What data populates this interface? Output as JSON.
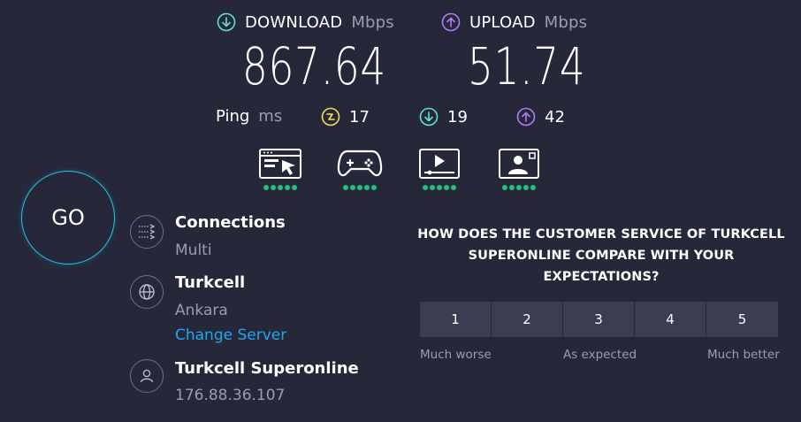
{
  "download": {
    "label": "DOWNLOAD",
    "unit": "Mbps",
    "value": "867.64",
    "icon": "download-arrow-icon",
    "color": "#5ee3d6"
  },
  "upload": {
    "label": "UPLOAD",
    "unit": "Mbps",
    "value": "51.74",
    "icon": "upload-arrow-icon",
    "color": "#b07cf5"
  },
  "ping": {
    "label": "Ping",
    "unit": "ms",
    "idle": {
      "value": "17",
      "icon": "idle-ping-icon",
      "color": "#f5df5a"
    },
    "download": {
      "value": "19",
      "icon": "download-ping-icon",
      "color": "#5ee3d6"
    },
    "upload": {
      "value": "42",
      "icon": "upload-ping-icon",
      "color": "#b07cf5"
    }
  },
  "activities": [
    {
      "name": "web-browsing-icon",
      "rating": 5
    },
    {
      "name": "gaming-icon",
      "rating": 5
    },
    {
      "name": "video-streaming-icon",
      "rating": 5
    },
    {
      "name": "video-chat-icon",
      "rating": 5
    }
  ],
  "go_button": {
    "label": "GO"
  },
  "connections": {
    "title": "Connections",
    "value": "Multi"
  },
  "server": {
    "title": "Turkcell",
    "location": "Ankara",
    "change_label": "Change Server"
  },
  "provider": {
    "title": "Turkcell Superonline",
    "ip": "176.88.36.107"
  },
  "survey": {
    "question_lines": [
      "HOW DOES THE CUSTOMER SERVICE OF TURKCELL",
      "SUPERONLINE COMPARE WITH YOUR",
      "EXPECTATIONS?"
    ],
    "options": [
      "1",
      "2",
      "3",
      "4",
      "5"
    ],
    "low_label": "Much worse",
    "mid_label": "As expected",
    "high_label": "Much better"
  },
  "colors": {
    "background": "#262839",
    "accent_go": "#1ec8e6",
    "link": "#1fa8ef",
    "good": "#22c27a"
  }
}
